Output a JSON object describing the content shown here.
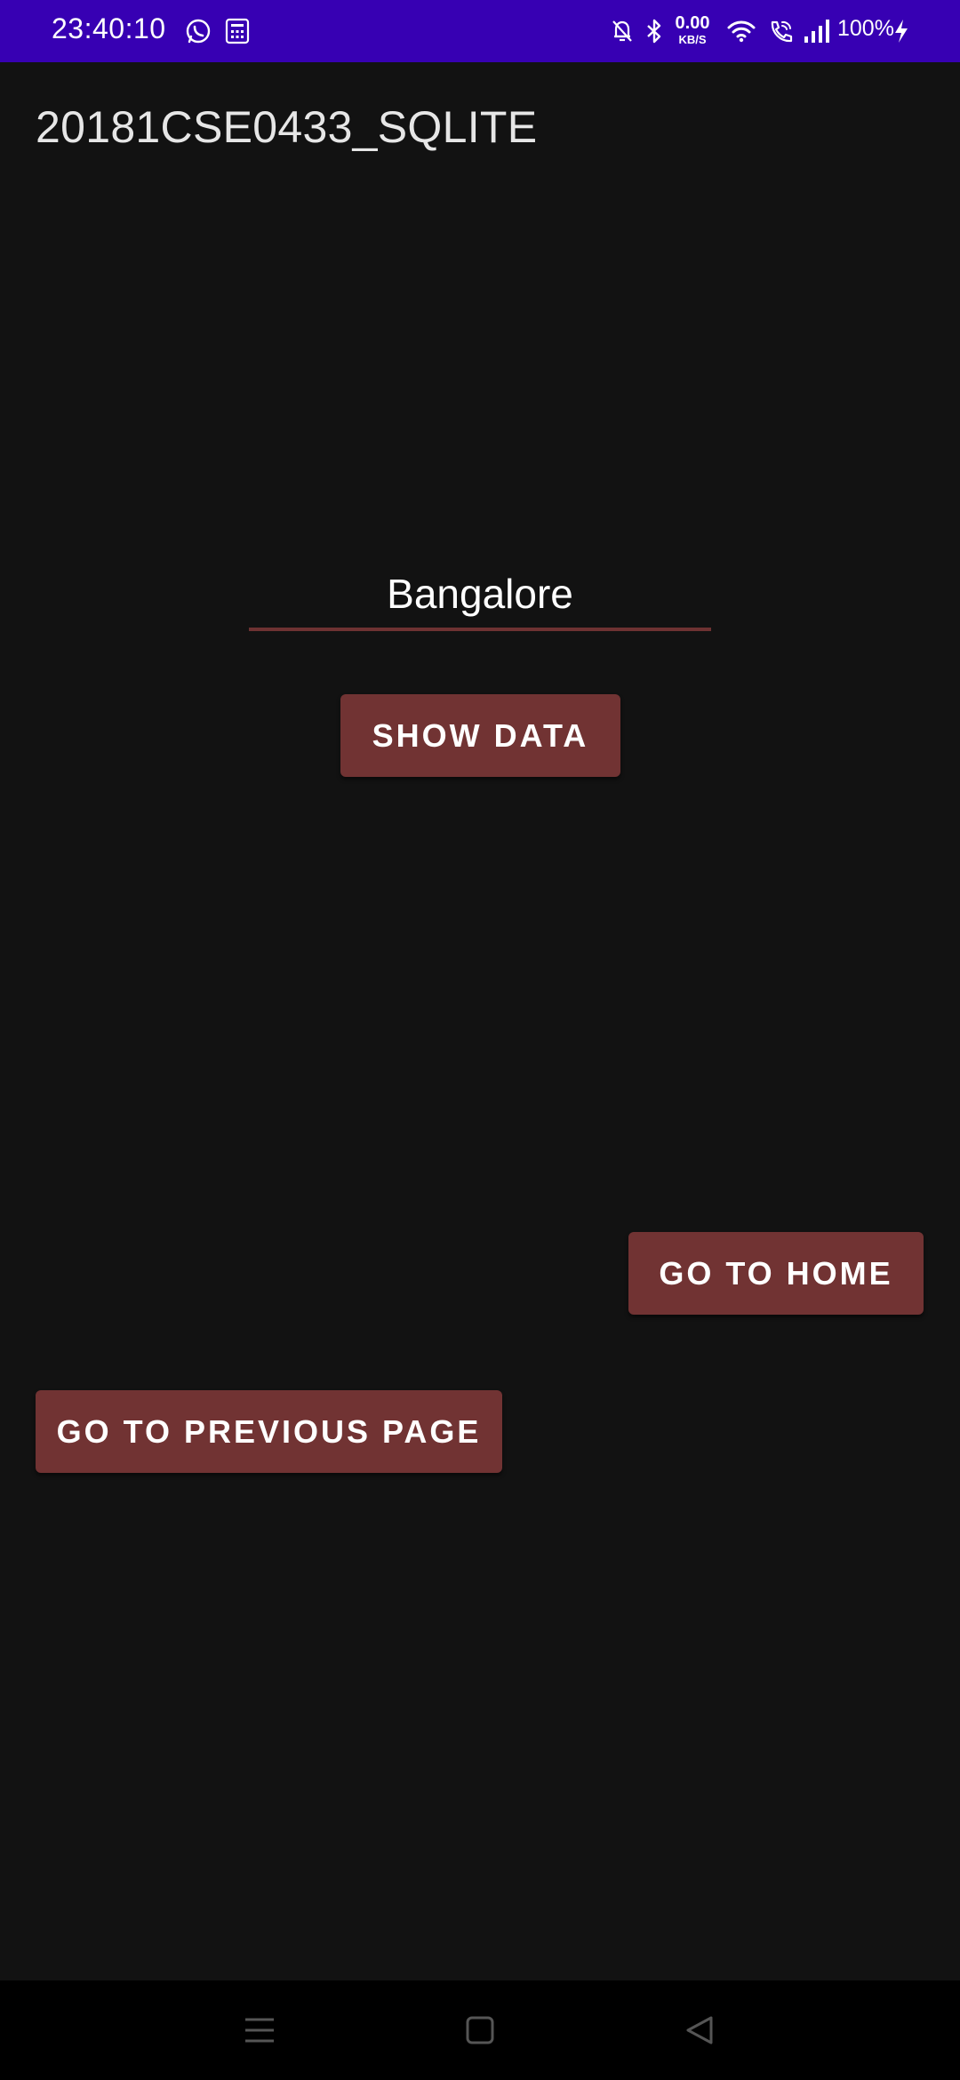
{
  "status_bar": {
    "time": "23:40:10",
    "net_speed_value": "0.00",
    "net_speed_unit": "KB/S",
    "battery": "100%",
    "icons": [
      "whatsapp-icon",
      "calculator-icon",
      "mute-bell-icon",
      "bluetooth-icon",
      "wifi-icon",
      "wifi-calling-icon",
      "signal-icon",
      "charging-icon"
    ]
  },
  "app_bar": {
    "title": "20181CSE0433_SQLITE"
  },
  "form": {
    "city_value": "Bangalore"
  },
  "buttons": {
    "show_data": "SHOW DATA",
    "go_home": "GO TO HOME",
    "go_previous": "GO TO PREVIOUS PAGE"
  },
  "nav_bar": {
    "icons": [
      "menu-icon",
      "home-square-icon",
      "back-triangle-icon"
    ]
  },
  "colors": {
    "status_bar": "#3700b3",
    "background": "#121212",
    "button": "#713333",
    "field_underline": "#6e3232"
  }
}
